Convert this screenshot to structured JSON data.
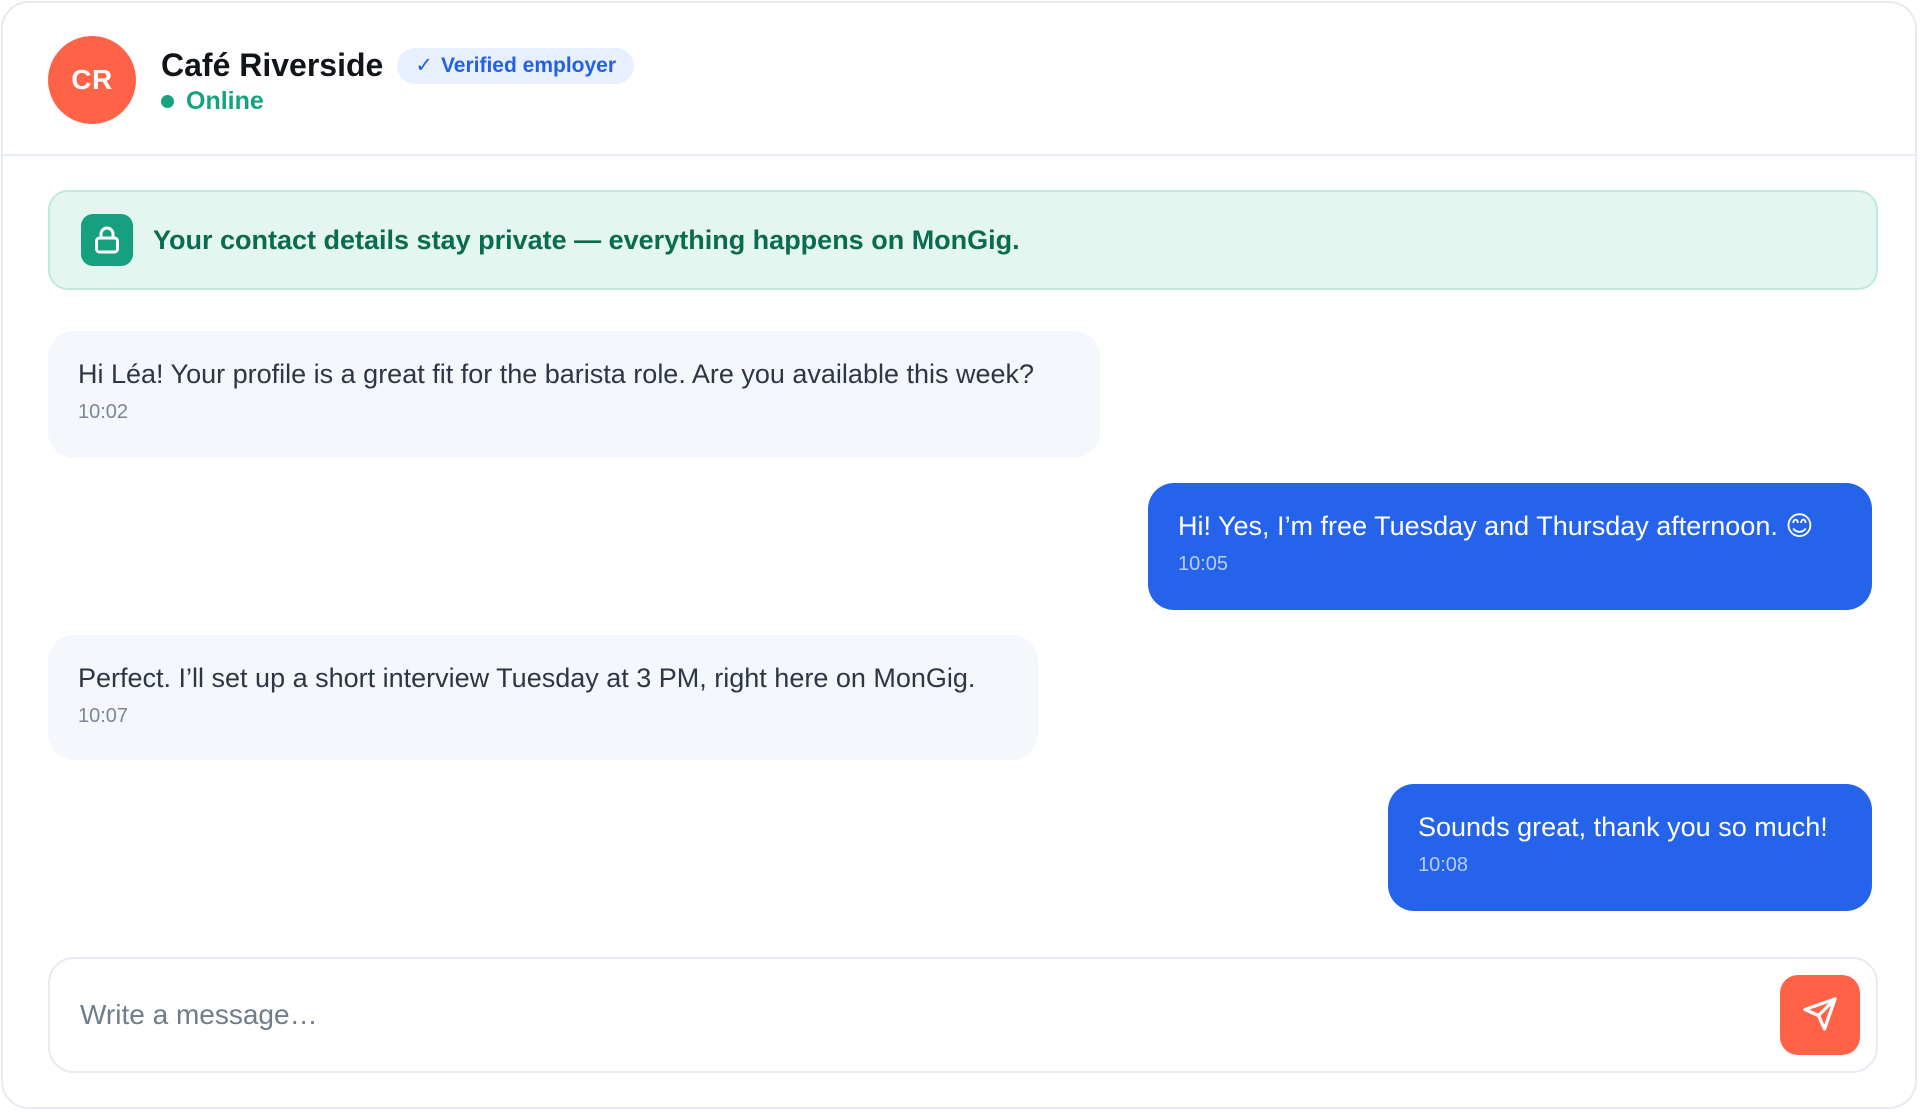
{
  "header": {
    "avatar_initials": "CR",
    "name": "Café Riverside",
    "badge": {
      "check": "✓",
      "label": "Verified employer"
    },
    "status": "Online"
  },
  "privacy_notice": "Your contact details stay private — everything happens on MonGig.",
  "messages": [
    {
      "direction": "incoming",
      "text": "Hi Léa! Your profile is a great fit for the barista role. Are you available this week?",
      "time": "10:02"
    },
    {
      "direction": "outgoing",
      "text": "Hi! Yes, I’m free Tuesday and Thursday afternoon. 😊",
      "time": "10:05"
    },
    {
      "direction": "incoming",
      "text": "Perfect. I’ll set up a short interview Tuesday at 3 PM, right here on MonGig.",
      "time": "10:07"
    },
    {
      "direction": "outgoing",
      "text": "Sounds great, thank you so much!",
      "time": "10:08"
    }
  ],
  "composer": {
    "value": "",
    "placeholder": "Write a message…"
  },
  "icons": {
    "privacy": "lock-icon",
    "send": "send-icon"
  },
  "colors": {
    "accent": "#ff6347",
    "outgoing_bubble": "#2563eb",
    "incoming_bubble": "#f4f7fb",
    "online": "#15a37f",
    "privacy_bg": "#e3f7f0",
    "badge_text": "#2360e2"
  }
}
